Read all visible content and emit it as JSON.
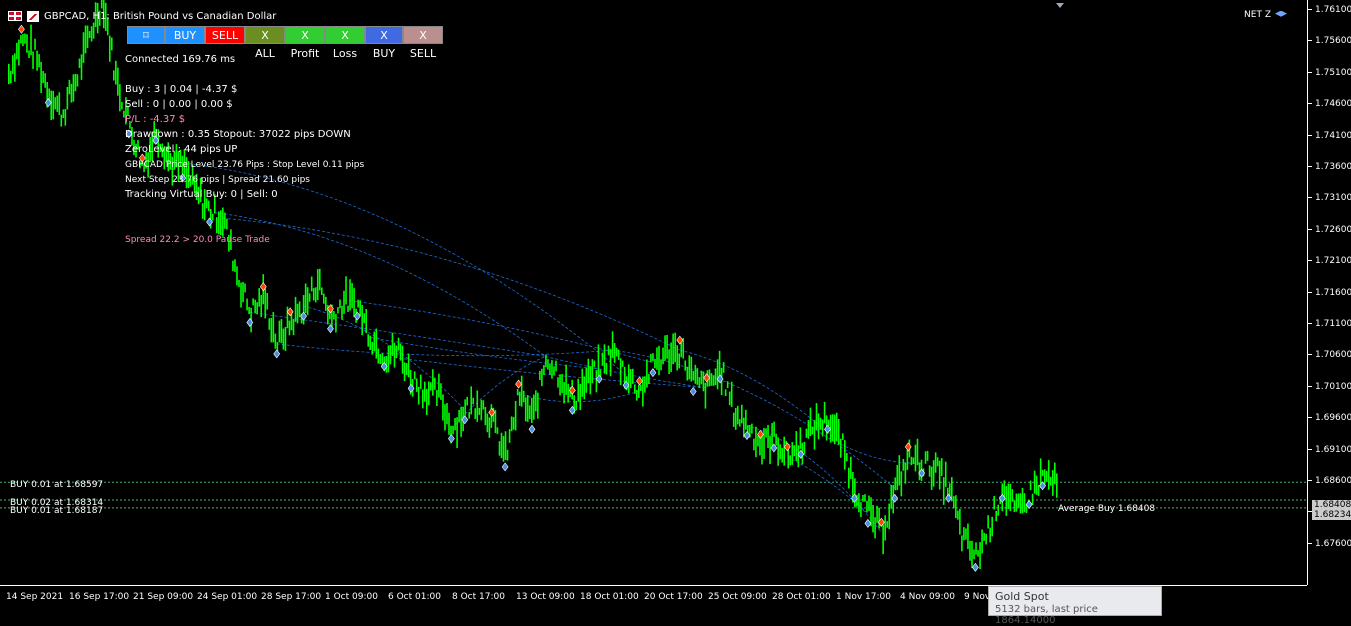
{
  "window": {
    "title": "GBPCAD, H1: British Pound vs Canadian Dollar",
    "account_label": "NET Z"
  },
  "toolbar": [
    {
      "label": "⌑",
      "name": "focus-button",
      "color": "#1e90ff",
      "width": 38
    },
    {
      "label": "BUY",
      "name": "buy-button",
      "color": "#1e90ff",
      "width": 40
    },
    {
      "label": "SELL",
      "name": "sell-button",
      "color": "#ff0000",
      "width": 40
    },
    {
      "label": "X ALL",
      "name": "close-all-button",
      "color": "#6b8e23",
      "width": 40
    },
    {
      "label": "X Profit",
      "name": "close-profit-button",
      "color": "#32cd32",
      "width": 40
    },
    {
      "label": "X Loss",
      "name": "close-loss-button",
      "color": "#32cd32",
      "width": 40
    },
    {
      "label": "X BUY",
      "name": "close-buy-button",
      "color": "#4169e1",
      "width": 38
    },
    {
      "label": "X SELL",
      "name": "close-sell-button",
      "color": "#bc8f8f",
      "width": 40
    }
  ],
  "info": {
    "connected": "Connected 169.76 ms",
    "buy": "Buy : 3 | 0.04 | -4.37 $",
    "sell": "Sell : 0 | 0.00 | 0.00 $",
    "pl": "P/L : -4.37 $",
    "drawdown": "Drawdown : 0.35 Stopout: 37022 pips DOWN",
    "zerolevel": "ZeroLevel : 44 pips UP",
    "pricelevel": "GBPCAD Price Level 23.76 Pips : Stop Level 0.11 pips",
    "nextstep": "Next Step 23.76 pips | Spread 21.60 pips",
    "tracking": "Tracking Virtual Buy: 0 | Sell: 0",
    "spread_warning": "Spread 22.2 > 20.0 Pause Trade"
  },
  "order_lines": [
    {
      "label": "BUY 0.01 at 1.68597",
      "price": 1.68597
    },
    {
      "label": "BUY 0.02 at 1.68314",
      "price": 1.68314
    },
    {
      "label": "BUY 0.01 at 1.68187",
      "price": 1.68187
    }
  ],
  "average_buy_label": "Average Buy 1.68408",
  "price_boxes": [
    {
      "text": "1.68408",
      "price": 1.68408
    },
    {
      "text": "1.68234",
      "price": 1.68234
    }
  ],
  "y_axis": {
    "min": 1.6655,
    "max": 1.7625,
    "ticks": [
      "1.76100",
      "1.75600",
      "1.75100",
      "1.74600",
      "1.74100",
      "1.73600",
      "1.73100",
      "1.72600",
      "1.72100",
      "1.71600",
      "1.71100",
      "1.70600",
      "1.70100",
      "1.69600",
      "1.69100",
      "1.68600",
      "1.68100",
      "1.67600"
    ]
  },
  "x_axis": {
    "ticks": [
      "14 Sep 2021",
      "16 Sep 17:00",
      "21 Sep 09:00",
      "24 Sep 01:00",
      "28 Sep 17:00",
      "1 Oct 09:00",
      "6 Oct 01:00",
      "8 Oct 17:00",
      "13 Oct 09:00",
      "18 Oct 01:00",
      "20 Oct 17:00",
      "25 Oct 09:00",
      "28 Oct 01:00",
      "1 Nov 17:00",
      "4 Nov 09:00",
      "9 Nov"
    ]
  },
  "tooltip": {
    "title": "Gold Spot",
    "subtitle": "5132 bars, last price 1864.14000"
  },
  "colors": {
    "candle": "#00ff00",
    "order_line": "#3cb371",
    "trend_line": "#1e6bd6",
    "buy_marker": "#4a90e2",
    "sell_marker": "#ff4500"
  },
  "chart_data": {
    "type": "line",
    "series": [
      {
        "values": [
          1.751,
          1.7565,
          1.754,
          1.748,
          1.7445,
          1.75,
          1.757,
          1.763,
          1.75,
          1.743,
          1.736,
          1.742,
          1.737,
          1.736,
          1.732,
          1.729,
          1.728,
          1.719,
          1.713,
          1.7155,
          1.708,
          1.7115,
          1.714,
          1.718,
          1.712,
          1.715,
          1.714,
          1.709,
          1.706,
          1.707,
          1.7025,
          1.7005,
          1.7,
          1.6945,
          1.6975,
          1.699,
          1.6955,
          1.69,
          1.7,
          1.696,
          1.706,
          1.703,
          1.699,
          1.702,
          1.704,
          1.707,
          1.703,
          1.7005,
          1.705,
          1.7065,
          1.707,
          1.702,
          1.701,
          1.704,
          1.697,
          1.695,
          1.692,
          1.693,
          1.69,
          1.692,
          1.695,
          1.696,
          1.692,
          1.685,
          1.681,
          1.678,
          1.685,
          1.69,
          1.689,
          1.688,
          1.685,
          1.677,
          1.674,
          1.679,
          1.685,
          1.681,
          1.684,
          1.687,
          1.6855
        ]
      }
    ],
    "ylim": [
      1.6655,
      1.7625
    ]
  }
}
